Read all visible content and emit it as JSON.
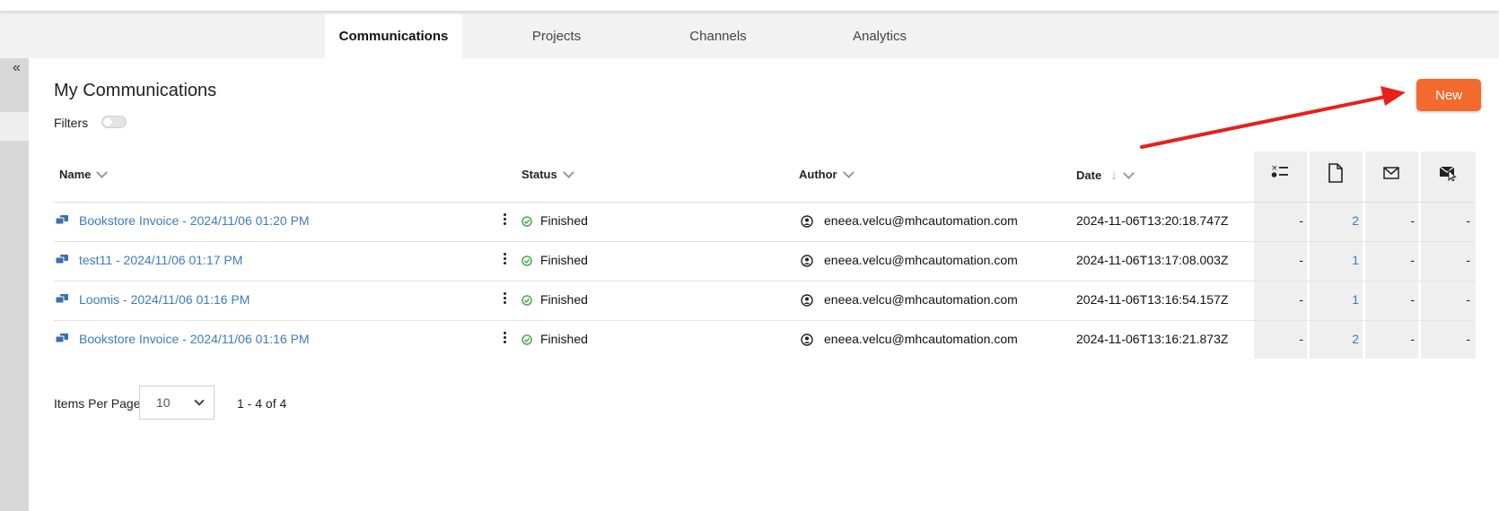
{
  "nav": {
    "tabs": [
      {
        "label": "Communications",
        "active": true
      },
      {
        "label": "Projects",
        "active": false
      },
      {
        "label": "Channels",
        "active": false
      },
      {
        "label": "Analytics",
        "active": false
      }
    ]
  },
  "sidebar": {
    "collapse_glyph": "«"
  },
  "page": {
    "title": "My Communications",
    "filters_label": "Filters",
    "filters_enabled": false,
    "new_button": "New"
  },
  "table": {
    "columns": {
      "name": "Name",
      "status": "Status",
      "author": "Author",
      "date": "Date"
    },
    "icon_columns": [
      "checklist-icon",
      "document-icon",
      "envelope-icon",
      "envelope-cursor-icon"
    ],
    "rows": [
      {
        "name": "Bookstore Invoice - 2024/11/06 01:20 PM",
        "status": "Finished",
        "author": "eneea.velcu@mhcautomation.com",
        "date": "2024-11-06T13:20:18.747Z",
        "c1": "-",
        "c2": "2",
        "c3": "-",
        "c4": "-"
      },
      {
        "name": "test11 - 2024/11/06 01:17 PM",
        "status": "Finished",
        "author": "eneea.velcu@mhcautomation.com",
        "date": "2024-11-06T13:17:08.003Z",
        "c1": "-",
        "c2": "1",
        "c3": "-",
        "c4": "-"
      },
      {
        "name": "Loomis - 2024/11/06 01:16 PM",
        "status": "Finished",
        "author": "eneea.velcu@mhcautomation.com",
        "date": "2024-11-06T13:16:54.157Z",
        "c1": "-",
        "c2": "1",
        "c3": "-",
        "c4": "-"
      },
      {
        "name": "Bookstore Invoice - 2024/11/06 01:16 PM",
        "status": "Finished",
        "author": "eneea.velcu@mhcautomation.com",
        "date": "2024-11-06T13:16:21.873Z",
        "c1": "-",
        "c2": "2",
        "c3": "-",
        "c4": "-"
      }
    ]
  },
  "pagination": {
    "items_per_page_label": "Items Per Page",
    "items_per_page_value": "10",
    "range": "1 - 4 of 4"
  },
  "colors": {
    "accent": "#f26a2e",
    "link": "#3b7bbf",
    "status_ok": "#4caf50",
    "annotation_arrow": "#e8201a"
  }
}
